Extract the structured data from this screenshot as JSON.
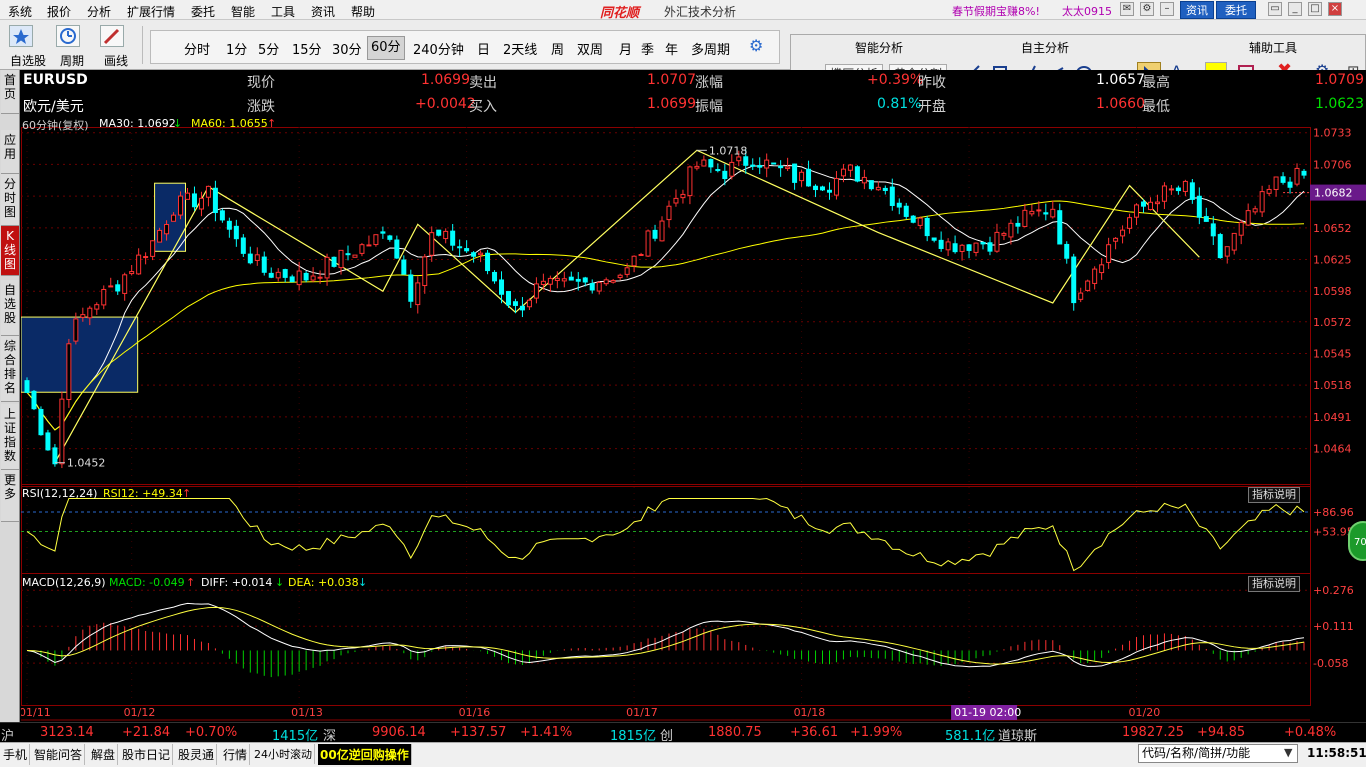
{
  "menu": [
    "系统",
    "报价",
    "分析",
    "扩展行情",
    "委托",
    "智能",
    "工具",
    "资讯",
    "帮助"
  ],
  "app_logo": "同花顺",
  "window_title": "外汇技术分析",
  "promo": "春节假期宝赚8%!",
  "user": "太太0915",
  "top_buttons": [
    "资讯",
    "委托"
  ],
  "toolbar": {
    "left_labels": [
      "自选股",
      "周期",
      "画线"
    ],
    "periods": [
      "分时",
      "1分",
      "5分",
      "15分",
      "30分",
      "60分",
      "240分钟",
      "日",
      "2天线",
      "周",
      "双周",
      "月",
      "季",
      "年",
      "多周期"
    ],
    "selected_period": "60分",
    "smart_title": "智能分析",
    "smart_buttons": [
      "撑压分析",
      "黄金分割"
    ],
    "self_title": "自主分析",
    "aux_title": "辅助工具"
  },
  "left_tabs": [
    "首页",
    "应用",
    "分时图",
    "K线图",
    "自选股",
    "综合排名",
    "上证指数",
    "更多"
  ],
  "quote": {
    "code": "EURUSD",
    "name": "欧元/美元",
    "now_label": "现价",
    "now": "1.0699",
    "sell_label": "卖出",
    "sell": "1.0707",
    "rise_label": "涨幅",
    "rise": "+0.39%",
    "prev_label": "昨收",
    "prev": "1.0657",
    "high_label": "最高",
    "high": "1.0709",
    "chg_label": "涨跌",
    "chg": "+0.0042",
    "buy_label": "买入",
    "buy": "1.0699",
    "amp_label": "振幅",
    "amp": "0.81%",
    "open_label": "开盘",
    "open": "1.0660",
    "low_label": "最低",
    "low": "1.0623"
  },
  "indicator_line": {
    "period": "60分钟(复权)",
    "ma30": "MA30: 1.0692",
    "ma60": "MA60: 1.0655"
  },
  "rsi_label": "RSI(12,12,24)",
  "rsi_value": "RSI12: +49.34",
  "macd_label": "MACD(12,26,9)",
  "macd_value": "MACD: -0.049",
  "diff_value": "DIFF: +0.014",
  "dea_value": "DEA: +0.038",
  "explain_button": "指标说明",
  "circle_value": "70",
  "price_marks": {
    "high": "1.0718",
    "low": "1.0452"
  },
  "current_price_tag": "1.0682",
  "cursor_time": "01-19 02:00",
  "chart_data": {
    "type": "candlestick",
    "price_axis": [
      "1.0733",
      "1.0706",
      "1.0679",
      "1.0652",
      "1.0625",
      "1.0598",
      "1.0572",
      "1.0545",
      "1.0518",
      "1.0491",
      "1.0464"
    ],
    "price_ylim": [
      1.0433,
      1.0737
    ],
    "rsi_axis": [
      "+86.96",
      "+53.95"
    ],
    "rsi_levels": [
      80,
      53.95
    ],
    "macd_axis": [
      "+0.276",
      "+0.111",
      "-0.058"
    ],
    "macd_ylim": [
      -0.25,
      0.3
    ],
    "date_labels": [
      {
        "i": 0,
        "t": "01/11"
      },
      {
        "i": 15,
        "t": "01/12"
      },
      {
        "i": 39,
        "t": "01/13"
      },
      {
        "i": 63,
        "t": "01/16"
      },
      {
        "i": 87,
        "t": "01/17"
      },
      {
        "i": 111,
        "t": "01/18"
      },
      {
        "i": 135,
        "t": "01/19"
      },
      {
        "i": 159,
        "t": "01/20"
      }
    ],
    "cursor_index": 133,
    "anchors": [
      [
        0,
        1.0512
      ],
      [
        4,
        1.0452
      ],
      [
        6,
        1.056
      ],
      [
        9,
        1.0585
      ],
      [
        13,
        1.0605
      ],
      [
        18,
        1.064
      ],
      [
        21,
        1.067
      ],
      [
        26,
        1.068
      ],
      [
        30,
        1.064
      ],
      [
        34,
        1.0615
      ],
      [
        40,
        1.061
      ],
      [
        46,
        1.063
      ],
      [
        52,
        1.0648
      ],
      [
        55,
        1.0596
      ],
      [
        58,
        1.0645
      ],
      [
        61,
        1.064
      ],
      [
        65,
        1.0625
      ],
      [
        70,
        1.0582
      ],
      [
        73,
        1.06
      ],
      [
        80,
        1.0605
      ],
      [
        86,
        1.0615
      ],
      [
        91,
        1.066
      ],
      [
        96,
        1.0705
      ],
      [
        100,
        1.07
      ],
      [
        104,
        1.0712
      ],
      [
        110,
        1.0695
      ],
      [
        115,
        1.069
      ],
      [
        118,
        1.07
      ],
      [
        122,
        1.069
      ],
      [
        127,
        1.066
      ],
      [
        132,
        1.0638
      ],
      [
        138,
        1.064
      ],
      [
        143,
        1.066
      ],
      [
        147,
        1.067
      ],
      [
        150,
        1.0595
      ],
      [
        153,
        1.062
      ],
      [
        158,
        1.066
      ],
      [
        162,
        1.068
      ],
      [
        166,
        1.0685
      ],
      [
        169,
        1.065
      ],
      [
        171,
        1.0628
      ],
      [
        175,
        1.066
      ],
      [
        179,
        1.069
      ],
      [
        182,
        1.0695
      ]
    ],
    "zigzag": [
      [
        4,
        1.0452
      ],
      [
        26,
        1.0687
      ],
      [
        51,
        1.0598
      ],
      [
        56,
        1.0655
      ],
      [
        70,
        1.058
      ],
      [
        96,
        1.0718
      ],
      [
        122,
        1.0648
      ],
      [
        147,
        1.0588
      ],
      [
        158,
        1.0688
      ],
      [
        168,
        1.0627
      ]
    ]
  }
}
